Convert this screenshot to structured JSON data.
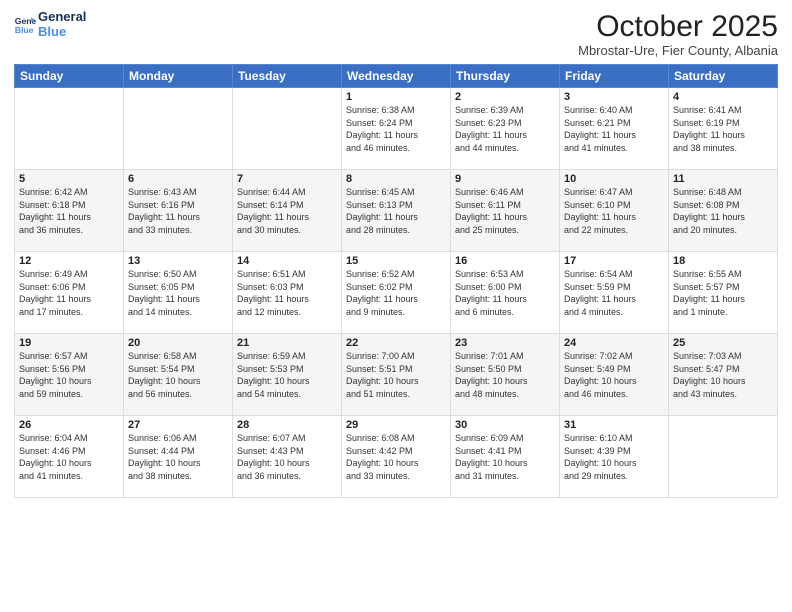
{
  "logo": {
    "line1": "General",
    "line2": "Blue"
  },
  "title": "October 2025",
  "subtitle": "Mbrostar-Ure, Fier County, Albania",
  "days_header": [
    "Sunday",
    "Monday",
    "Tuesday",
    "Wednesday",
    "Thursday",
    "Friday",
    "Saturday"
  ],
  "weeks": [
    [
      {
        "day": "",
        "info": ""
      },
      {
        "day": "",
        "info": ""
      },
      {
        "day": "",
        "info": ""
      },
      {
        "day": "1",
        "info": "Sunrise: 6:38 AM\nSunset: 6:24 PM\nDaylight: 11 hours\nand 46 minutes."
      },
      {
        "day": "2",
        "info": "Sunrise: 6:39 AM\nSunset: 6:23 PM\nDaylight: 11 hours\nand 44 minutes."
      },
      {
        "day": "3",
        "info": "Sunrise: 6:40 AM\nSunset: 6:21 PM\nDaylight: 11 hours\nand 41 minutes."
      },
      {
        "day": "4",
        "info": "Sunrise: 6:41 AM\nSunset: 6:19 PM\nDaylight: 11 hours\nand 38 minutes."
      }
    ],
    [
      {
        "day": "5",
        "info": "Sunrise: 6:42 AM\nSunset: 6:18 PM\nDaylight: 11 hours\nand 36 minutes."
      },
      {
        "day": "6",
        "info": "Sunrise: 6:43 AM\nSunset: 6:16 PM\nDaylight: 11 hours\nand 33 minutes."
      },
      {
        "day": "7",
        "info": "Sunrise: 6:44 AM\nSunset: 6:14 PM\nDaylight: 11 hours\nand 30 minutes."
      },
      {
        "day": "8",
        "info": "Sunrise: 6:45 AM\nSunset: 6:13 PM\nDaylight: 11 hours\nand 28 minutes."
      },
      {
        "day": "9",
        "info": "Sunrise: 6:46 AM\nSunset: 6:11 PM\nDaylight: 11 hours\nand 25 minutes."
      },
      {
        "day": "10",
        "info": "Sunrise: 6:47 AM\nSunset: 6:10 PM\nDaylight: 11 hours\nand 22 minutes."
      },
      {
        "day": "11",
        "info": "Sunrise: 6:48 AM\nSunset: 6:08 PM\nDaylight: 11 hours\nand 20 minutes."
      }
    ],
    [
      {
        "day": "12",
        "info": "Sunrise: 6:49 AM\nSunset: 6:06 PM\nDaylight: 11 hours\nand 17 minutes."
      },
      {
        "day": "13",
        "info": "Sunrise: 6:50 AM\nSunset: 6:05 PM\nDaylight: 11 hours\nand 14 minutes."
      },
      {
        "day": "14",
        "info": "Sunrise: 6:51 AM\nSunset: 6:03 PM\nDaylight: 11 hours\nand 12 minutes."
      },
      {
        "day": "15",
        "info": "Sunrise: 6:52 AM\nSunset: 6:02 PM\nDaylight: 11 hours\nand 9 minutes."
      },
      {
        "day": "16",
        "info": "Sunrise: 6:53 AM\nSunset: 6:00 PM\nDaylight: 11 hours\nand 6 minutes."
      },
      {
        "day": "17",
        "info": "Sunrise: 6:54 AM\nSunset: 5:59 PM\nDaylight: 11 hours\nand 4 minutes."
      },
      {
        "day": "18",
        "info": "Sunrise: 6:55 AM\nSunset: 5:57 PM\nDaylight: 11 hours\nand 1 minute."
      }
    ],
    [
      {
        "day": "19",
        "info": "Sunrise: 6:57 AM\nSunset: 5:56 PM\nDaylight: 10 hours\nand 59 minutes."
      },
      {
        "day": "20",
        "info": "Sunrise: 6:58 AM\nSunset: 5:54 PM\nDaylight: 10 hours\nand 56 minutes."
      },
      {
        "day": "21",
        "info": "Sunrise: 6:59 AM\nSunset: 5:53 PM\nDaylight: 10 hours\nand 54 minutes."
      },
      {
        "day": "22",
        "info": "Sunrise: 7:00 AM\nSunset: 5:51 PM\nDaylight: 10 hours\nand 51 minutes."
      },
      {
        "day": "23",
        "info": "Sunrise: 7:01 AM\nSunset: 5:50 PM\nDaylight: 10 hours\nand 48 minutes."
      },
      {
        "day": "24",
        "info": "Sunrise: 7:02 AM\nSunset: 5:49 PM\nDaylight: 10 hours\nand 46 minutes."
      },
      {
        "day": "25",
        "info": "Sunrise: 7:03 AM\nSunset: 5:47 PM\nDaylight: 10 hours\nand 43 minutes."
      }
    ],
    [
      {
        "day": "26",
        "info": "Sunrise: 6:04 AM\nSunset: 4:46 PM\nDaylight: 10 hours\nand 41 minutes."
      },
      {
        "day": "27",
        "info": "Sunrise: 6:06 AM\nSunset: 4:44 PM\nDaylight: 10 hours\nand 38 minutes."
      },
      {
        "day": "28",
        "info": "Sunrise: 6:07 AM\nSunset: 4:43 PM\nDaylight: 10 hours\nand 36 minutes."
      },
      {
        "day": "29",
        "info": "Sunrise: 6:08 AM\nSunset: 4:42 PM\nDaylight: 10 hours\nand 33 minutes."
      },
      {
        "day": "30",
        "info": "Sunrise: 6:09 AM\nSunset: 4:41 PM\nDaylight: 10 hours\nand 31 minutes."
      },
      {
        "day": "31",
        "info": "Sunrise: 6:10 AM\nSunset: 4:39 PM\nDaylight: 10 hours\nand 29 minutes."
      },
      {
        "day": "",
        "info": ""
      }
    ]
  ]
}
